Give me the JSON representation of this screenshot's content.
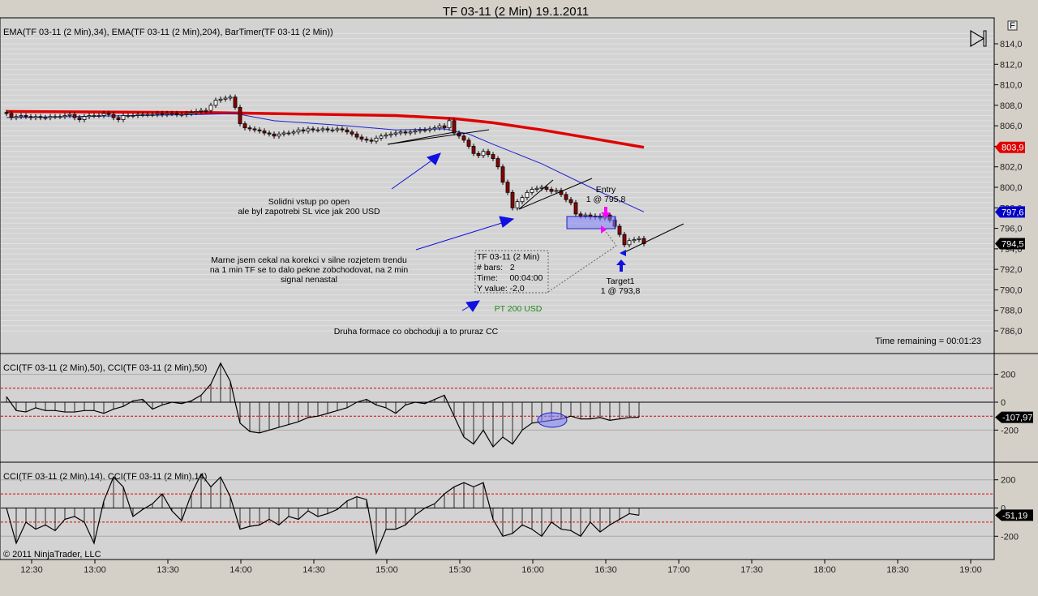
{
  "window": {
    "title": "TF 03-11 (2 Min)  19.1.2011"
  },
  "toolbar": {
    "f_button": "F",
    "play_icon": "skip-to-end-icon"
  },
  "main_panel": {
    "indicator_label": "EMA(TF 03-11 (2 Min),34), EMA(TF 03-11 (2 Min),204), BarTimer(TF 03-11 (2 Min))",
    "price_ticks": [
      "814,0",
      "812,0",
      "810,0",
      "808,0",
      "806,0",
      "804,0",
      "802,0",
      "800,0",
      "798,0",
      "796,0",
      "794,0",
      "792,0",
      "790,0",
      "788,0",
      "786,0"
    ],
    "price_tags": [
      {
        "label": "803,9",
        "value": 803.9,
        "color": "#e00000"
      },
      {
        "label": "797,6",
        "value": 797.6,
        "color": "#0000c8"
      },
      {
        "label": "794,5",
        "value": 794.5,
        "color": "#000000"
      }
    ],
    "time_remaining": "Time remaining = 00:01:23",
    "annotations": {
      "solidni_1": "Solidni vstup po open",
      "solidni_2": "ale byl zapotrebi SL vice jak 200 USD",
      "marne_1": "Marne jsem cekal na korekci v silne rozjetem trendu",
      "marne_2": "na 1 min TF se to dalo pekne zobchodovat, na 2 min",
      "marne_3": "signal nenastal",
      "pt": "PT 200 USD",
      "druha": "Druha formace co obchoduji a to pruraz CC",
      "entry_1": "Entry",
      "entry_2": "1 @ 795,8",
      "target_1": "Target1",
      "target_2": "1 @ 793,8"
    },
    "measure_box": {
      "line1": "TF 03-11 (2 Min)",
      "line2": "# bars:   2",
      "line3": "Time:     00:04:00",
      "line4": "Y value: -2,0"
    }
  },
  "cci50_panel": {
    "label": "CCI(TF 03-11 (2 Min),50), CCI(TF 03-11 (2 Min),50)",
    "ticks": [
      "200",
      "0",
      "-200"
    ],
    "tag": "-107,97",
    "values": [
      40,
      -60,
      -70,
      -40,
      -60,
      -60,
      -70,
      -70,
      -60,
      -60,
      -80,
      -50,
      -30,
      10,
      20,
      -50,
      -20,
      0,
      -10,
      10,
      50,
      130,
      280,
      150,
      -150,
      -210,
      -220,
      -200,
      -180,
      -160,
      -140,
      -110,
      -100,
      -80,
      -60,
      -40,
      0,
      20,
      -20,
      -40,
      -80,
      -20,
      0,
      -10,
      20,
      50,
      -100,
      -250,
      -300,
      -200,
      -320,
      -250,
      -300,
      -200,
      -150,
      -140,
      -130,
      -120,
      -100,
      -120,
      -120,
      -110,
      -130,
      -120,
      -110,
      -108
    ]
  },
  "cci14_panel": {
    "label": "CCI(TF 03-11 (2 Min),14), CCI(TF 03-11 (2 Min),14)",
    "ticks": [
      "200",
      "0",
      "-200"
    ],
    "tag": "-51,19",
    "values": [
      0,
      -250,
      -100,
      -150,
      -120,
      -160,
      -80,
      -60,
      -100,
      -250,
      50,
      220,
      150,
      -60,
      -10,
      30,
      100,
      -20,
      -90,
      100,
      240,
      150,
      220,
      80,
      -150,
      -130,
      -120,
      -80,
      -120,
      -60,
      -80,
      -20,
      -60,
      -40,
      -10,
      50,
      80,
      60,
      -320,
      -150,
      -150,
      -120,
      -50,
      0,
      30,
      100,
      150,
      180,
      150,
      180,
      -80,
      -200,
      -180,
      -120,
      -150,
      -200,
      -100,
      -150,
      -160,
      -200,
      -100,
      -170,
      -120,
      -80,
      -40,
      -51
    ]
  },
  "copyright": "© 2011 NinjaTrader, LLC",
  "time_axis": [
    "12:30",
    "13:00",
    "13:30",
    "14:00",
    "14:30",
    "15:00",
    "15:30",
    "16:00",
    "16:30",
    "17:00",
    "17:30",
    "18:00",
    "18:30",
    "19:00"
  ],
  "chart_data": {
    "type": "candlestick",
    "instrument": "TF 03-11 (2 Min)",
    "first_bar_time": "12:24",
    "bar_minutes": 2,
    "closes": [
      807.2,
      806.8,
      806.9,
      807.0,
      806.9,
      806.8,
      806.9,
      806.8,
      806.8,
      806.9,
      806.9,
      806.9,
      807.0,
      807.1,
      806.8,
      806.6,
      806.9,
      807.0,
      807.0,
      807.0,
      807.2,
      807.1,
      806.8,
      806.6,
      807.0,
      807.0,
      807.0,
      807.1,
      807.1,
      807.1,
      807.1,
      807.2,
      807.1,
      807.2,
      807.2,
      807.1,
      807.1,
      807.2,
      807.3,
      807.4,
      807.5,
      807.5,
      808.0,
      808.5,
      808.6,
      808.7,
      808.8,
      807.8,
      806.2,
      805.8,
      805.7,
      805.6,
      805.5,
      805.3,
      805.2,
      805.0,
      805.2,
      805.3,
      805.3,
      805.4,
      805.6,
      805.5,
      805.7,
      805.6,
      805.6,
      805.7,
      805.6,
      805.6,
      805.7,
      805.6,
      805.4,
      805.2,
      804.9,
      804.7,
      804.6,
      804.5,
      804.8,
      805.0,
      805.1,
      805.2,
      805.3,
      805.4,
      805.3,
      805.4,
      805.5,
      805.6,
      805.6,
      805.7,
      805.8,
      806.0,
      805.8,
      806.5,
      805.3,
      805.0,
      804.6,
      804.0,
      803.3,
      803.1,
      803.5,
      803.2,
      802.8,
      802.0,
      800.5,
      799.5,
      798.0,
      798.6,
      799.0,
      799.5,
      799.8,
      799.9,
      800.0,
      799.8,
      799.6,
      799.7,
      799.3,
      798.8,
      798.5,
      797.4,
      797.2,
      797.3,
      797.1,
      797.2,
      797.0,
      797.3,
      796.8,
      796.2,
      795.4,
      794.4,
      794.8,
      794.9,
      795.0,
      794.5
    ],
    "ema34": [
      [
        0,
        806.8
      ],
      [
        40,
        807.1
      ],
      [
        47,
        807.2
      ],
      [
        55,
        806.5
      ],
      [
        70,
        806.0
      ],
      [
        80,
        805.6
      ],
      [
        90,
        805.7
      ],
      [
        95,
        805.2
      ],
      [
        100,
        804.2
      ],
      [
        110,
        802.3
      ],
      [
        120,
        800.0
      ],
      [
        131,
        797.6
      ]
    ],
    "ema204": [
      [
        0,
        807.4
      ],
      [
        40,
        807.3
      ],
      [
        80,
        807.0
      ],
      [
        92,
        806.7
      ],
      [
        100,
        806.3
      ],
      [
        110,
        805.6
      ],
      [
        120,
        804.8
      ],
      [
        131,
        803.9
      ]
    ],
    "ylim": [
      785,
      815
    ],
    "colors": {
      "up": "#ffffff",
      "down": "#8b0000",
      "ema34": "#2020d0",
      "ema204": "#e00000"
    }
  }
}
